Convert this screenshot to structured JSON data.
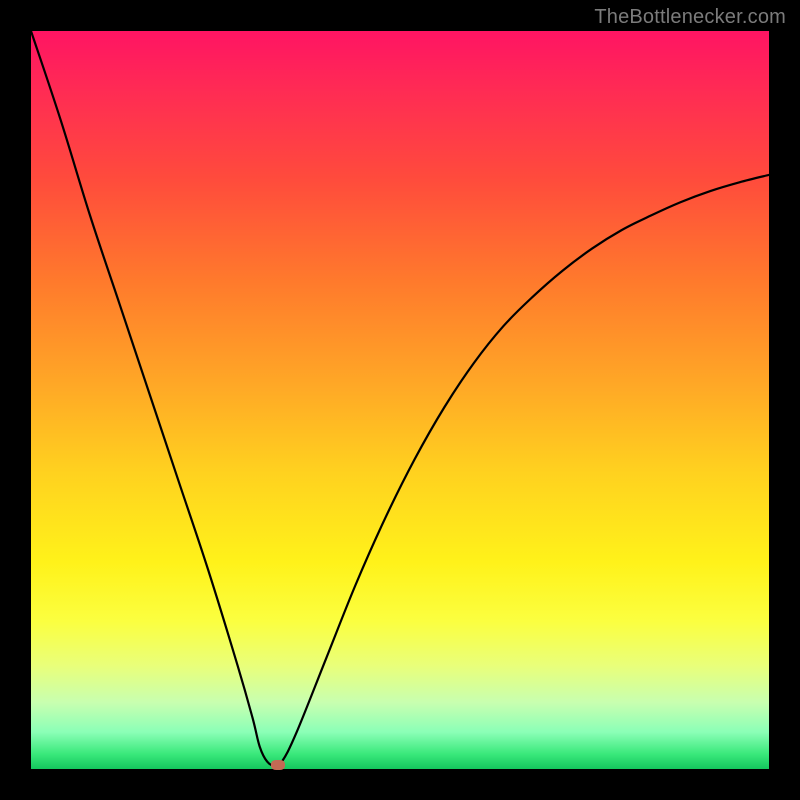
{
  "watermark": "TheBottlenecker.com",
  "chart_data": {
    "type": "line",
    "title": "",
    "xlabel": "",
    "ylabel": "",
    "xlim": [
      0,
      100
    ],
    "ylim": [
      0,
      100
    ],
    "note": "Gradient background from red (top, high bottleneck) to green (bottom, no bottleneck). Curve shows bottleneck severity with a minimum near x≈32.",
    "series": [
      {
        "name": "bottleneck-curve",
        "x": [
          0,
          4,
          8,
          12,
          16,
          20,
          24,
          28,
          30,
          31,
          32,
          33,
          34,
          36,
          40,
          44,
          48,
          52,
          56,
          60,
          64,
          68,
          72,
          76,
          80,
          84,
          88,
          92,
          96,
          100
        ],
        "values": [
          100,
          88,
          75,
          63,
          51,
          39,
          27,
          14,
          7,
          3,
          1,
          0.5,
          1,
          5,
          15,
          25,
          34,
          42,
          49,
          55,
          60,
          64,
          67.5,
          70.5,
          73,
          75,
          76.8,
          78.3,
          79.5,
          80.5
        ]
      }
    ],
    "marker": {
      "x": 33.5,
      "y": 0.5
    },
    "gradient_stops": [
      {
        "pos": 0,
        "color": "#ff1463"
      },
      {
        "pos": 50,
        "color": "#ffc21f"
      },
      {
        "pos": 80,
        "color": "#fbff40"
      },
      {
        "pos": 100,
        "color": "#14c75d"
      }
    ]
  }
}
